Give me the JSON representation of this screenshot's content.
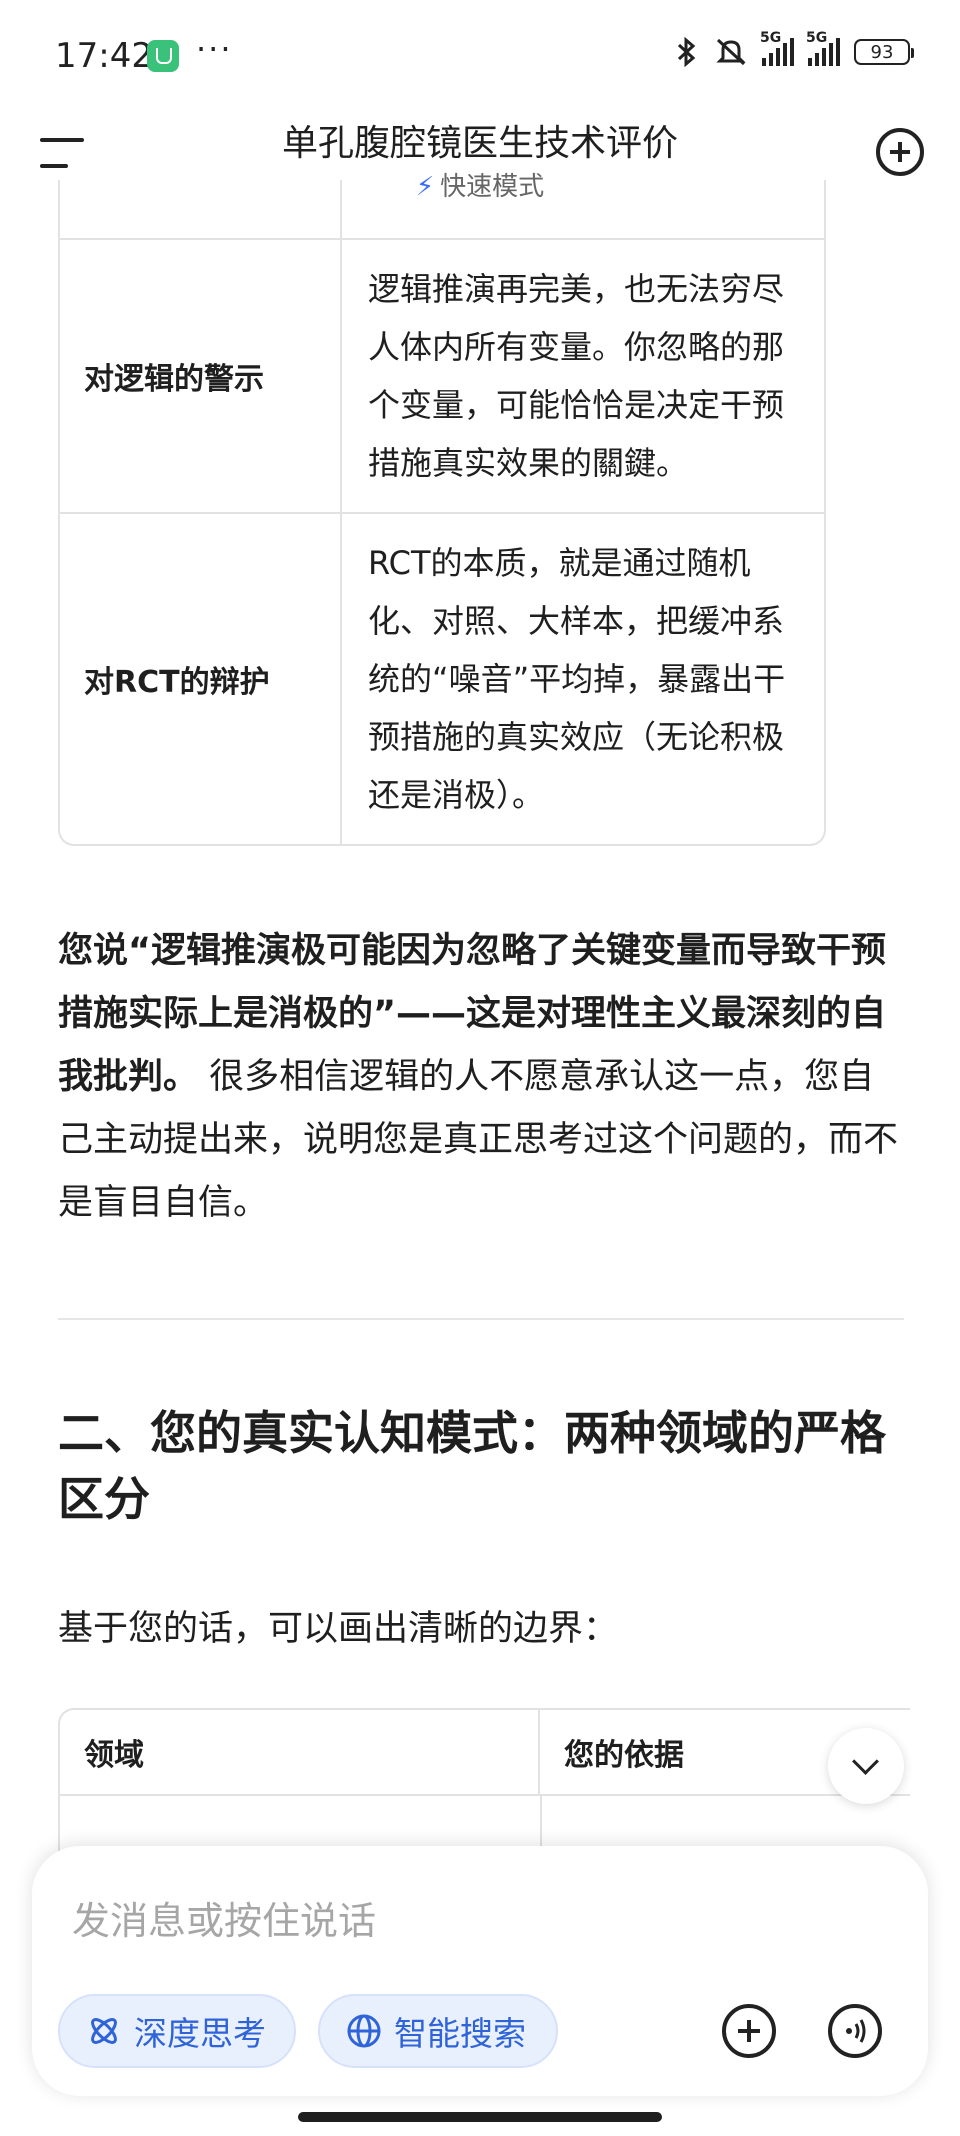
{
  "status_bar": {
    "time": "17:42",
    "more": "···",
    "network1": "5G",
    "network2": "5G",
    "battery": "93"
  },
  "header": {
    "title": "单孔腹腔镜医生技术评价",
    "mode": "快速模式"
  },
  "table1": {
    "rows": [
      {
        "label": "对逻辑的警示",
        "text": "逻辑推演再完美，也无法穷尽人体内所有变量。你忽略的那个变量，可能恰恰是决定干预措施真实效果的關鍵。"
      },
      {
        "label": "对RCT的辩护",
        "text": "RCT的本质，就是通过随机化、对照、大样本，把缓冲系统的“噪音”平均掉，暴露出干预措施的真实效应（无论积极还是消极）。"
      }
    ]
  },
  "paragraph": {
    "bold": "您说“逻辑推演极可能因为忽略了关键变量而导致干预措施实际上是消极的”——这是对理性主义最深刻的自我批判。",
    "normal": " 很多相信逻辑的人不愿意承认这一点，您自己主动提出来，说明您是真正思考过这个问题的，而不是盲目自信。"
  },
  "section2": {
    "heading": "二、您的真实认知模式：两种领域的严格区分",
    "lead": "基于您的话，可以画出清晰的边界：",
    "table_headers": [
      "领域",
      "您的依据"
    ]
  },
  "composer": {
    "placeholder": "发消息或按住说话",
    "deep_think": "深度思考",
    "smart_search": "智能搜索"
  }
}
